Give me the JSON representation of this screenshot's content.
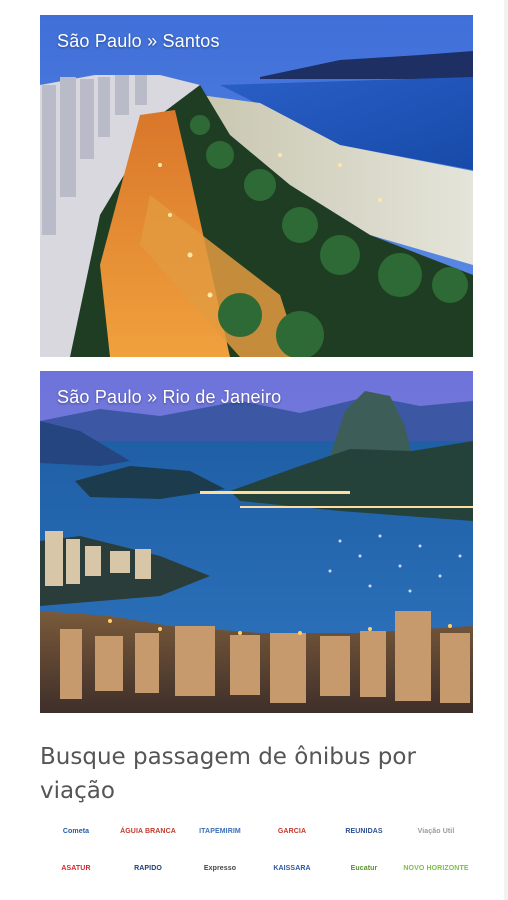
{
  "routes": [
    {
      "title": "São Paulo » Santos"
    },
    {
      "title": "São Paulo » Rio de Janeiro"
    }
  ],
  "section": {
    "title": "Busque passagem de ônibus por viação"
  },
  "companies": [
    {
      "name": "Cometa",
      "color": "#1e5aa8"
    },
    {
      "name": "ÁGUIA BRANCA",
      "color": "#c0392b"
    },
    {
      "name": "ITAPEMIRIM",
      "color": "#3a6fb7"
    },
    {
      "name": "GARCIA",
      "color": "#c2372e"
    },
    {
      "name": "REUNIDAS",
      "color": "#2d4f8f"
    },
    {
      "name": "Viação Util",
      "color": "#9a9a9a"
    },
    {
      "name": "ASATUR",
      "color": "#d3262d"
    },
    {
      "name": "RAPIDO",
      "color": "#1f3c78"
    },
    {
      "name": "Expresso",
      "color": "#444444"
    },
    {
      "name": "KAISSARA",
      "color": "#2b57a0"
    },
    {
      "name": "Eucatur",
      "color": "#5c8f2e"
    },
    {
      "name": "NOVO HORIZONTE",
      "color": "#7bc142"
    }
  ],
  "colors": {
    "title_text": "#555555",
    "overlay_text": "#ffffff"
  }
}
